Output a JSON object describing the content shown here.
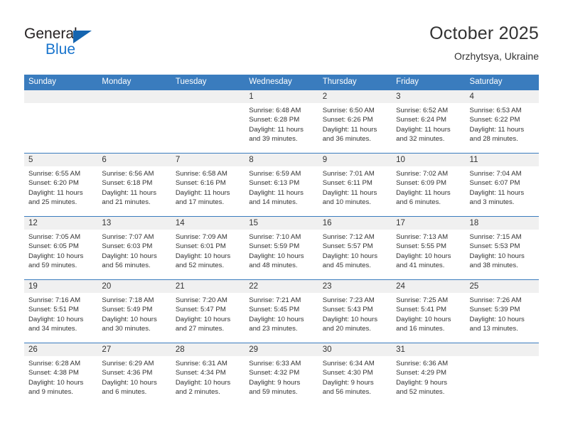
{
  "brand": {
    "name_part1": "General",
    "name_part2": "Blue",
    "accent_color": "#1874cd",
    "triangle_color": "#1565b0"
  },
  "header": {
    "title": "October 2025",
    "subtitle": "Orzhytsya, Ukraine"
  },
  "calendar": {
    "header_bg": "#3a7cbe",
    "daynum_bg": "#f0f0f0",
    "weekday_labels": [
      "Sunday",
      "Monday",
      "Tuesday",
      "Wednesday",
      "Thursday",
      "Friday",
      "Saturday"
    ],
    "weeks": [
      [
        {
          "day": "",
          "empty": true,
          "sunrise": "",
          "sunset": "",
          "daylight_line1": "",
          "daylight_line2": ""
        },
        {
          "day": "",
          "empty": true,
          "sunrise": "",
          "sunset": "",
          "daylight_line1": "",
          "daylight_line2": ""
        },
        {
          "day": "",
          "empty": true,
          "sunrise": "",
          "sunset": "",
          "daylight_line1": "",
          "daylight_line2": ""
        },
        {
          "day": "1",
          "empty": false,
          "sunrise": "Sunrise: 6:48 AM",
          "sunset": "Sunset: 6:28 PM",
          "daylight_line1": "Daylight: 11 hours",
          "daylight_line2": "and 39 minutes."
        },
        {
          "day": "2",
          "empty": false,
          "sunrise": "Sunrise: 6:50 AM",
          "sunset": "Sunset: 6:26 PM",
          "daylight_line1": "Daylight: 11 hours",
          "daylight_line2": "and 36 minutes."
        },
        {
          "day": "3",
          "empty": false,
          "sunrise": "Sunrise: 6:52 AM",
          "sunset": "Sunset: 6:24 PM",
          "daylight_line1": "Daylight: 11 hours",
          "daylight_line2": "and 32 minutes."
        },
        {
          "day": "4",
          "empty": false,
          "sunrise": "Sunrise: 6:53 AM",
          "sunset": "Sunset: 6:22 PM",
          "daylight_line1": "Daylight: 11 hours",
          "daylight_line2": "and 28 minutes."
        }
      ],
      [
        {
          "day": "5",
          "empty": false,
          "sunrise": "Sunrise: 6:55 AM",
          "sunset": "Sunset: 6:20 PM",
          "daylight_line1": "Daylight: 11 hours",
          "daylight_line2": "and 25 minutes."
        },
        {
          "day": "6",
          "empty": false,
          "sunrise": "Sunrise: 6:56 AM",
          "sunset": "Sunset: 6:18 PM",
          "daylight_line1": "Daylight: 11 hours",
          "daylight_line2": "and 21 minutes."
        },
        {
          "day": "7",
          "empty": false,
          "sunrise": "Sunrise: 6:58 AM",
          "sunset": "Sunset: 6:16 PM",
          "daylight_line1": "Daylight: 11 hours",
          "daylight_line2": "and 17 minutes."
        },
        {
          "day": "8",
          "empty": false,
          "sunrise": "Sunrise: 6:59 AM",
          "sunset": "Sunset: 6:13 PM",
          "daylight_line1": "Daylight: 11 hours",
          "daylight_line2": "and 14 minutes."
        },
        {
          "day": "9",
          "empty": false,
          "sunrise": "Sunrise: 7:01 AM",
          "sunset": "Sunset: 6:11 PM",
          "daylight_line1": "Daylight: 11 hours",
          "daylight_line2": "and 10 minutes."
        },
        {
          "day": "10",
          "empty": false,
          "sunrise": "Sunrise: 7:02 AM",
          "sunset": "Sunset: 6:09 PM",
          "daylight_line1": "Daylight: 11 hours",
          "daylight_line2": "and 6 minutes."
        },
        {
          "day": "11",
          "empty": false,
          "sunrise": "Sunrise: 7:04 AM",
          "sunset": "Sunset: 6:07 PM",
          "daylight_line1": "Daylight: 11 hours",
          "daylight_line2": "and 3 minutes."
        }
      ],
      [
        {
          "day": "12",
          "empty": false,
          "sunrise": "Sunrise: 7:05 AM",
          "sunset": "Sunset: 6:05 PM",
          "daylight_line1": "Daylight: 10 hours",
          "daylight_line2": "and 59 minutes."
        },
        {
          "day": "13",
          "empty": false,
          "sunrise": "Sunrise: 7:07 AM",
          "sunset": "Sunset: 6:03 PM",
          "daylight_line1": "Daylight: 10 hours",
          "daylight_line2": "and 56 minutes."
        },
        {
          "day": "14",
          "empty": false,
          "sunrise": "Sunrise: 7:09 AM",
          "sunset": "Sunset: 6:01 PM",
          "daylight_line1": "Daylight: 10 hours",
          "daylight_line2": "and 52 minutes."
        },
        {
          "day": "15",
          "empty": false,
          "sunrise": "Sunrise: 7:10 AM",
          "sunset": "Sunset: 5:59 PM",
          "daylight_line1": "Daylight: 10 hours",
          "daylight_line2": "and 48 minutes."
        },
        {
          "day": "16",
          "empty": false,
          "sunrise": "Sunrise: 7:12 AM",
          "sunset": "Sunset: 5:57 PM",
          "daylight_line1": "Daylight: 10 hours",
          "daylight_line2": "and 45 minutes."
        },
        {
          "day": "17",
          "empty": false,
          "sunrise": "Sunrise: 7:13 AM",
          "sunset": "Sunset: 5:55 PM",
          "daylight_line1": "Daylight: 10 hours",
          "daylight_line2": "and 41 minutes."
        },
        {
          "day": "18",
          "empty": false,
          "sunrise": "Sunrise: 7:15 AM",
          "sunset": "Sunset: 5:53 PM",
          "daylight_line1": "Daylight: 10 hours",
          "daylight_line2": "and 38 minutes."
        }
      ],
      [
        {
          "day": "19",
          "empty": false,
          "sunrise": "Sunrise: 7:16 AM",
          "sunset": "Sunset: 5:51 PM",
          "daylight_line1": "Daylight: 10 hours",
          "daylight_line2": "and 34 minutes."
        },
        {
          "day": "20",
          "empty": false,
          "sunrise": "Sunrise: 7:18 AM",
          "sunset": "Sunset: 5:49 PM",
          "daylight_line1": "Daylight: 10 hours",
          "daylight_line2": "and 30 minutes."
        },
        {
          "day": "21",
          "empty": false,
          "sunrise": "Sunrise: 7:20 AM",
          "sunset": "Sunset: 5:47 PM",
          "daylight_line1": "Daylight: 10 hours",
          "daylight_line2": "and 27 minutes."
        },
        {
          "day": "22",
          "empty": false,
          "sunrise": "Sunrise: 7:21 AM",
          "sunset": "Sunset: 5:45 PM",
          "daylight_line1": "Daylight: 10 hours",
          "daylight_line2": "and 23 minutes."
        },
        {
          "day": "23",
          "empty": false,
          "sunrise": "Sunrise: 7:23 AM",
          "sunset": "Sunset: 5:43 PM",
          "daylight_line1": "Daylight: 10 hours",
          "daylight_line2": "and 20 minutes."
        },
        {
          "day": "24",
          "empty": false,
          "sunrise": "Sunrise: 7:25 AM",
          "sunset": "Sunset: 5:41 PM",
          "daylight_line1": "Daylight: 10 hours",
          "daylight_line2": "and 16 minutes."
        },
        {
          "day": "25",
          "empty": false,
          "sunrise": "Sunrise: 7:26 AM",
          "sunset": "Sunset: 5:39 PM",
          "daylight_line1": "Daylight: 10 hours",
          "daylight_line2": "and 13 minutes."
        }
      ],
      [
        {
          "day": "26",
          "empty": false,
          "sunrise": "Sunrise: 6:28 AM",
          "sunset": "Sunset: 4:38 PM",
          "daylight_line1": "Daylight: 10 hours",
          "daylight_line2": "and 9 minutes."
        },
        {
          "day": "27",
          "empty": false,
          "sunrise": "Sunrise: 6:29 AM",
          "sunset": "Sunset: 4:36 PM",
          "daylight_line1": "Daylight: 10 hours",
          "daylight_line2": "and 6 minutes."
        },
        {
          "day": "28",
          "empty": false,
          "sunrise": "Sunrise: 6:31 AM",
          "sunset": "Sunset: 4:34 PM",
          "daylight_line1": "Daylight: 10 hours",
          "daylight_line2": "and 2 minutes."
        },
        {
          "day": "29",
          "empty": false,
          "sunrise": "Sunrise: 6:33 AM",
          "sunset": "Sunset: 4:32 PM",
          "daylight_line1": "Daylight: 9 hours",
          "daylight_line2": "and 59 minutes."
        },
        {
          "day": "30",
          "empty": false,
          "sunrise": "Sunrise: 6:34 AM",
          "sunset": "Sunset: 4:30 PM",
          "daylight_line1": "Daylight: 9 hours",
          "daylight_line2": "and 56 minutes."
        },
        {
          "day": "31",
          "empty": false,
          "sunrise": "Sunrise: 6:36 AM",
          "sunset": "Sunset: 4:29 PM",
          "daylight_line1": "Daylight: 9 hours",
          "daylight_line2": "and 52 minutes."
        },
        {
          "day": "",
          "empty": true,
          "sunrise": "",
          "sunset": "",
          "daylight_line1": "",
          "daylight_line2": ""
        }
      ]
    ]
  }
}
